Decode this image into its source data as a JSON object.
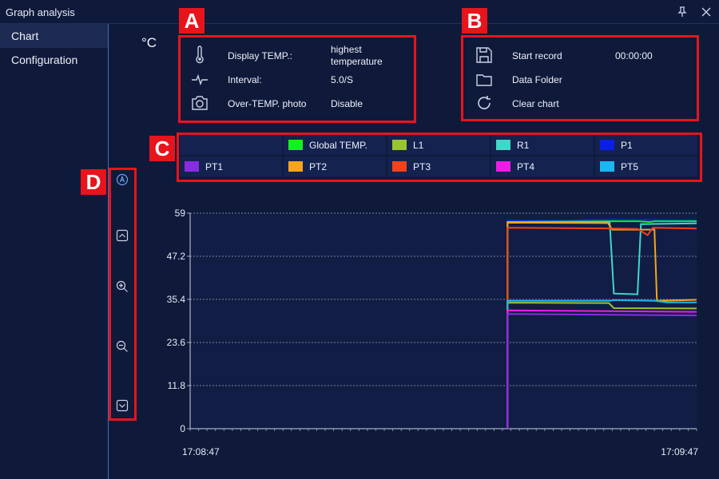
{
  "window": {
    "title": "Graph analysis"
  },
  "sidebar": {
    "items": [
      {
        "label": "Chart",
        "active": true
      },
      {
        "label": "Configuration",
        "active": false
      }
    ]
  },
  "unit_label": "°C",
  "callouts": {
    "a": "A",
    "b": "B",
    "c": "C",
    "d": "D"
  },
  "panel_a": {
    "rows": [
      {
        "icon": "thermometer-icon",
        "label": "Display TEMP.:",
        "value_line1": "highest",
        "value_line2": "temperature"
      },
      {
        "icon": "pulse-icon",
        "label": "Interval:",
        "value": "5.0/S"
      },
      {
        "icon": "camera-icon",
        "label": "Over-TEMP. photo",
        "value": "Disable"
      }
    ]
  },
  "panel_b": {
    "rows": [
      {
        "icon": "save-icon",
        "label": "Start record",
        "value": "00:00:00"
      },
      {
        "icon": "folder-icon",
        "label": "Data Folder"
      },
      {
        "icon": "refresh-icon",
        "label": "Clear chart"
      }
    ]
  },
  "legend": {
    "entries": [
      {
        "name": "Global TEMP.",
        "color": "#0df51a"
      },
      {
        "name": "L1",
        "color": "#9ac531"
      },
      {
        "name": "R1",
        "color": "#40d6c8"
      },
      {
        "name": "P1",
        "color": "#0a1fe6"
      },
      {
        "name": "PT1",
        "color": "#8a2be2"
      },
      {
        "name": "PT2",
        "color": "#f5a51a"
      },
      {
        "name": "PT3",
        "color": "#f2421a"
      },
      {
        "name": "PT4",
        "color": "#f21ae6"
      },
      {
        "name": "PT5",
        "color": "#1ab8f2"
      }
    ]
  },
  "toolbar": {
    "items": [
      {
        "icon": "auto-scale-icon"
      },
      {
        "icon": "scroll-up-icon"
      },
      {
        "icon": "zoom-in-icon"
      },
      {
        "icon": "zoom-out-icon"
      },
      {
        "icon": "scroll-down-icon"
      }
    ]
  },
  "chart_data": {
    "type": "line",
    "ylim": [
      0,
      59
    ],
    "yticks": [
      "0",
      "11.8",
      "23.6",
      "35.4",
      "47.2",
      "59"
    ],
    "xticks": [
      "17:08:47",
      "17:09:47"
    ],
    "xlim": [
      0,
      60
    ],
    "grid": true,
    "series": [
      {
        "name": "P1",
        "color": "#0a1fe6",
        "points": [
          [
            37.6,
            0
          ],
          [
            37.6,
            57
          ],
          [
            45,
            57
          ],
          [
            47,
            57.2
          ],
          [
            50,
            57.3
          ],
          [
            55,
            57.2
          ],
          [
            60,
            57.1
          ]
        ]
      },
      {
        "name": "Global TEMP.",
        "color": "#0df51a",
        "points": [
          [
            37.6,
            0
          ],
          [
            37.6,
            56.6
          ],
          [
            50,
            56.8
          ],
          [
            53,
            56.8
          ],
          [
            54.5,
            56.6
          ],
          [
            55,
            56.8
          ],
          [
            60,
            56.8
          ]
        ]
      },
      {
        "name": "R1",
        "color": "#40d6c8",
        "points": [
          [
            37.6,
            0
          ],
          [
            37.6,
            56.5
          ],
          [
            49.7,
            56.5
          ],
          [
            50.2,
            37
          ],
          [
            53,
            36.8
          ],
          [
            53.4,
            56
          ],
          [
            60,
            56.2
          ]
        ]
      },
      {
        "name": "PT2",
        "color": "#f5a51a",
        "points": [
          [
            37.6,
            0
          ],
          [
            37.6,
            56.4
          ],
          [
            49.5,
            56.3
          ],
          [
            50,
            54.5
          ],
          [
            55,
            54.5
          ],
          [
            55.3,
            35
          ],
          [
            60,
            35.3
          ]
        ]
      },
      {
        "name": "PT3",
        "color": "#f2421a",
        "points": [
          [
            37.6,
            0
          ],
          [
            37.6,
            55
          ],
          [
            50,
            54.8
          ],
          [
            53,
            54.7
          ],
          [
            54.2,
            53
          ],
          [
            54.8,
            55
          ],
          [
            60,
            54.8
          ]
        ]
      },
      {
        "name": "L1",
        "color": "#9ac531",
        "points": [
          [
            37.6,
            0
          ],
          [
            37.6,
            34.5
          ],
          [
            49.6,
            34.4
          ],
          [
            50.2,
            33
          ],
          [
            60,
            32.9
          ]
        ]
      },
      {
        "name": "PT5",
        "color": "#1ab8f2",
        "points": [
          [
            37.6,
            0
          ],
          [
            37.6,
            35
          ],
          [
            49.8,
            35
          ],
          [
            50.2,
            35.2
          ],
          [
            55,
            35
          ],
          [
            56.5,
            34.6
          ],
          [
            60,
            34.6
          ]
        ]
      },
      {
        "name": "PT4",
        "color": "#f21ae6",
        "points": [
          [
            37.6,
            0
          ],
          [
            37.6,
            32.4
          ],
          [
            60,
            32
          ]
        ]
      },
      {
        "name": "PT1",
        "color": "#8a2be2",
        "points": [
          [
            37.6,
            0
          ],
          [
            37.6,
            31.4
          ],
          [
            60,
            31
          ]
        ]
      }
    ]
  }
}
